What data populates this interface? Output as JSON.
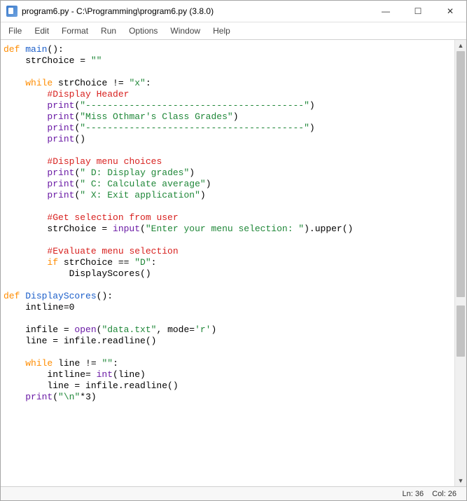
{
  "titlebar": {
    "title": "program6.py - C:\\Programming\\program6.py (3.8.0)"
  },
  "menubar": {
    "items": [
      "File",
      "Edit",
      "Format",
      "Run",
      "Options",
      "Window",
      "Help"
    ]
  },
  "statusbar": {
    "line_label": "Ln:",
    "line": "36",
    "col_label": "Col:",
    "col": "26"
  },
  "icons": {
    "minimize": "—",
    "maximize": "☐",
    "close": "✕",
    "up": "▲",
    "down": "▼"
  },
  "code": {
    "l01_kw": "def ",
    "l01_name": "main",
    "l01_tail": "():",
    "l02_a": "    strChoice = ",
    "l02_s": "\"\"",
    "l03": "",
    "l04_a": "    ",
    "l04_kw": "while",
    "l04_b": " strChoice != ",
    "l04_s": "\"x\"",
    "l04_c": ":",
    "l05_a": "        ",
    "l05_c": "#Display Header",
    "l06_a": "        ",
    "l06_f": "print",
    "l06_b": "(",
    "l06_s": "\"----------------------------------------\"",
    "l06_c": ")",
    "l07_a": "        ",
    "l07_f": "print",
    "l07_b": "(",
    "l07_s": "\"Miss Othmar's Class Grades\"",
    "l07_c": ")",
    "l08_a": "        ",
    "l08_f": "print",
    "l08_b": "(",
    "l08_s": "\"----------------------------------------\"",
    "l08_c": ")",
    "l09_a": "        ",
    "l09_f": "print",
    "l09_b": "()",
    "l10": "",
    "l11_a": "        ",
    "l11_c": "#Display menu choices",
    "l12_a": "        ",
    "l12_f": "print",
    "l12_b": "(",
    "l12_s": "\" D: Display grades\"",
    "l12_c": ")",
    "l13_a": "        ",
    "l13_f": "print",
    "l13_b": "(",
    "l13_s": "\" C: Calculate average\"",
    "l13_c": ")",
    "l14_a": "        ",
    "l14_f": "print",
    "l14_b": "(",
    "l14_s": "\" X: Exit application\"",
    "l14_c": ")",
    "l15": "",
    "l16_a": "        ",
    "l16_c": "#Get selection from user",
    "l17_a": "        strChoice = ",
    "l17_f": "input",
    "l17_b": "(",
    "l17_s": "\"Enter your menu selection: \"",
    "l17_c": ").upper()",
    "l18": "",
    "l19_a": "        ",
    "l19_c": "#Evaluate menu selection",
    "l20_a": "        ",
    "l20_kw": "if",
    "l20_b": " strChoice == ",
    "l20_s": "\"D\"",
    "l20_c": ":",
    "l21_a": "            DisplayScores()",
    "l22": "",
    "l23_kw": "def ",
    "l23_name": "DisplayScores",
    "l23_tail": "():",
    "l24_a": "    intline=",
    "l24_n": "0",
    "l25": "",
    "l26_a": "    infile = ",
    "l26_f": "open",
    "l26_b": "(",
    "l26_s1": "\"data.txt\"",
    "l26_c": ", mode=",
    "l26_s2": "'r'",
    "l26_d": ")",
    "l27_a": "    line = infile.readline()",
    "l28": "",
    "l29_a": "    ",
    "l29_kw": "while",
    "l29_b": " line != ",
    "l29_s": "\"\"",
    "l29_c": ":",
    "l30_a": "        intline= ",
    "l30_f": "int",
    "l30_b": "(line)",
    "l31_a": "        line = infile.readline()",
    "l32_a": "    ",
    "l32_f": "print",
    "l32_b": "(",
    "l32_s": "\"\\n\"",
    "l32_c": "*",
    "l32_n": "3",
    "l32_d": ")"
  }
}
